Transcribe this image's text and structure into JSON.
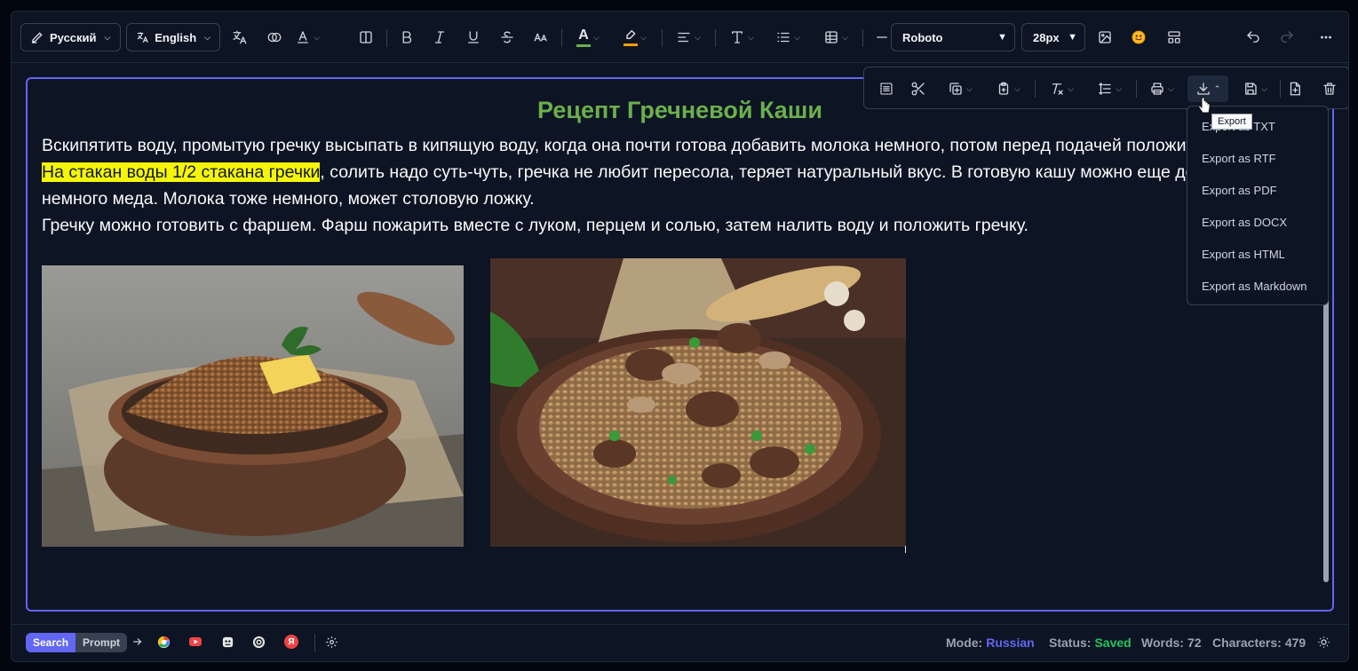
{
  "toolbar": {
    "source_lang": "Русский",
    "target_lang": "English",
    "font_family": "Roboto",
    "font_size": "28px",
    "text_color": "#6ab04c",
    "highlight_color": "#f59e0b",
    "text_letter": "A"
  },
  "document": {
    "title": "Рецепт Гречневой Каши",
    "line1": "Вскипятить воду, промытую гречку высыпать в кипящую воду, когда она почти готова добавить молока немного, потом перед подачей положить масло.",
    "highlight": "На стакан воды 1/2 стакана гречки",
    "line2_rest": ", солить надо суть-чуть, гречка не любит пересола, теряет натуральный вкус. В готовую кашу можно еще добавить",
    "line3": "немного меда. Молока тоже немного, может столовую ложку.",
    "line4": "Гречку можно готовить с фаршем. Фарш пожарить вместе с луком, перцем и солью, затем налить воду и положить гречку."
  },
  "export_menu": {
    "tooltip": "Export",
    "items": [
      "Export as TXT",
      "Export as RTF",
      "Export as PDF",
      "Export as DOCX",
      "Export as HTML",
      "Export as Markdown"
    ]
  },
  "status": {
    "search_label": "Search",
    "prompt_label": "Prompt",
    "mode_label": "Mode:",
    "mode_value": "Russian",
    "status_label": "Status:",
    "status_value": "Saved",
    "words_label": "Words:",
    "words_value": "72",
    "chars_label": "Characters:",
    "chars_value": "479",
    "yandex_letter": "Я",
    "colors": {
      "mode": "#6366f1",
      "saved": "#22c55e"
    }
  }
}
